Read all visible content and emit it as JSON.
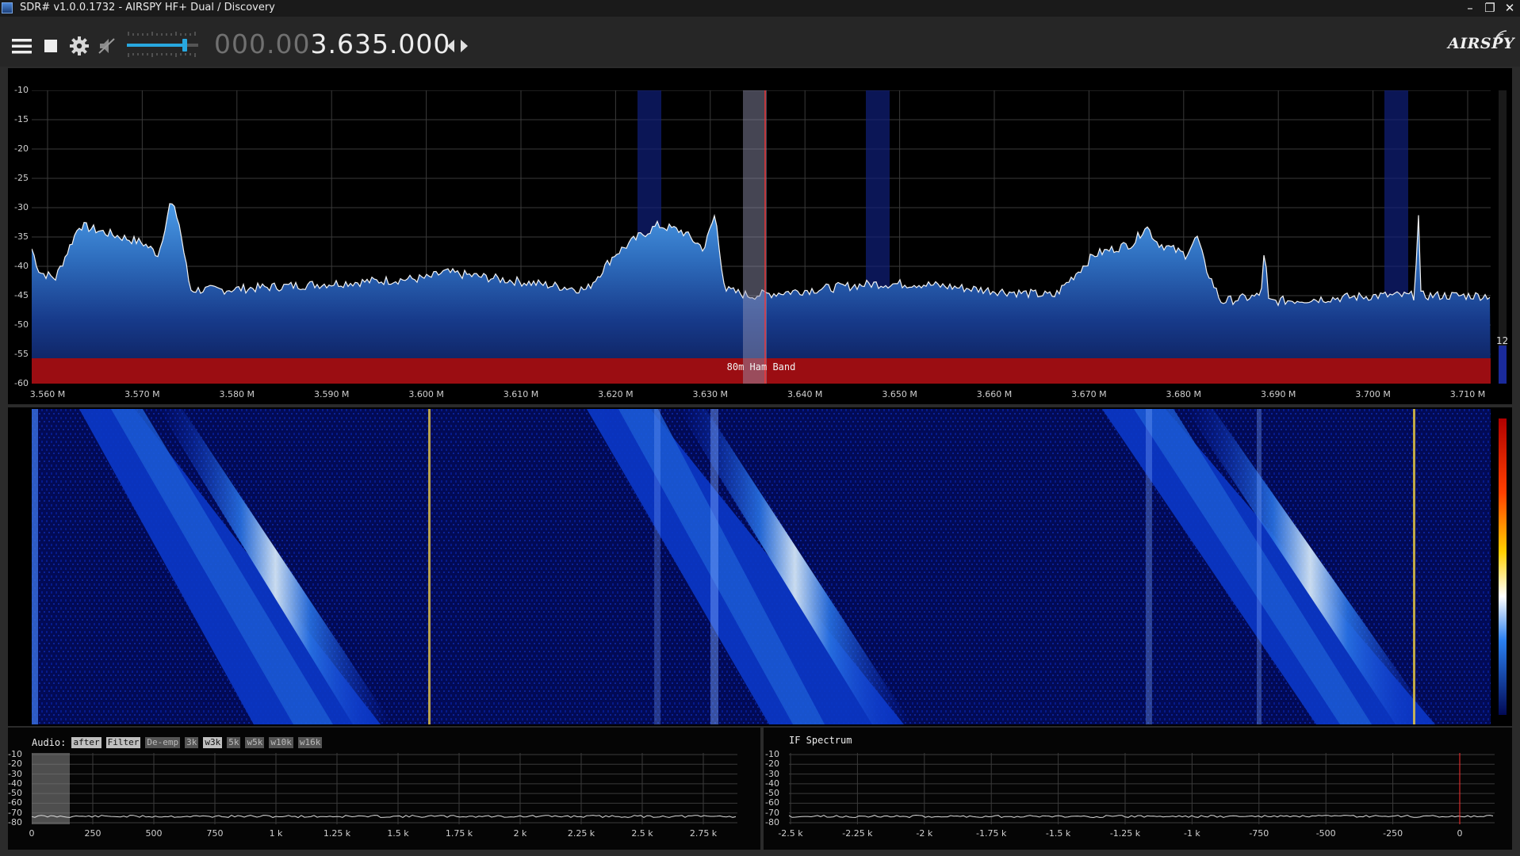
{
  "window": {
    "title": "SDR# v1.0.0.1732 - AIRSPY HF+ Dual / Discovery",
    "minimize_glyph": "–",
    "restore_glyph": "❐",
    "close_glyph": "✕"
  },
  "toolbar": {
    "frequency_dim": "000.00",
    "frequency_main": "3.635.000",
    "logo_text": "AIRSPY"
  },
  "spectrum": {
    "band_label": "80m Ham Band",
    "level_value": "12",
    "y_ticks": [
      "-10",
      "-15",
      "-20",
      "-25",
      "-30",
      "-35",
      "-40",
      "-45",
      "-50",
      "-55",
      "-60"
    ],
    "x_ticks": [
      "3.560 M",
      "3.570 M",
      "3.580 M",
      "3.590 M",
      "3.600 M",
      "3.610 M",
      "3.620 M",
      "3.630 M",
      "3.640 M",
      "3.650 M",
      "3.660 M",
      "3.670 M",
      "3.680 M",
      "3.690 M",
      "3.700 M",
      "3.710 M"
    ]
  },
  "audio": {
    "label": "Audio:",
    "options": [
      {
        "label": "after",
        "active": true
      },
      {
        "label": "Filter",
        "active": true
      },
      {
        "label": "De-emp",
        "active": false
      },
      {
        "label": "3k",
        "active": false
      },
      {
        "label": "w3k",
        "active": true
      },
      {
        "label": "5k",
        "active": false
      },
      {
        "label": "w5k",
        "active": false
      },
      {
        "label": "w10k",
        "active": false
      },
      {
        "label": "w16k",
        "active": false
      }
    ],
    "y_ticks": [
      "-10",
      "-20",
      "-30",
      "-40",
      "-50",
      "-60",
      "-70",
      "-80"
    ],
    "x_ticks": [
      "0",
      "250",
      "500",
      "750",
      "1 k",
      "1.25 k",
      "1.5 k",
      "1.75 k",
      "2 k",
      "2.25 k",
      "2.5 k",
      "2.75 k"
    ]
  },
  "if_spectrum": {
    "title": "IF Spectrum",
    "y_ticks": [
      "-10",
      "-20",
      "-30",
      "-40",
      "-50",
      "-60",
      "-70",
      "-80"
    ],
    "x_ticks": [
      "-2.5 k",
      "-2.25 k",
      "-2 k",
      "-1.75 k",
      "-1.5 k",
      "-1.25 k",
      "-1 k",
      "-750",
      "-500",
      "-250",
      "0"
    ]
  },
  "colors": {
    "background": "#2b2b2b",
    "spectrum_fill_top": "#3d8bd9",
    "spectrum_fill_bottom": "#0b1a52",
    "band_plan": "#9b0d12",
    "tuned_marker": "#ff3030",
    "waterfall_bg": "#020a55",
    "volume_slider": "#28a8e0"
  },
  "icons": {
    "menu": "hamburger-menu-icon",
    "stop": "stop-icon",
    "settings": "gear-icon",
    "mute": "speaker-muted-icon",
    "tune_step": "left-right-arrows-icon",
    "logo": "airspy-logo-icon"
  }
}
